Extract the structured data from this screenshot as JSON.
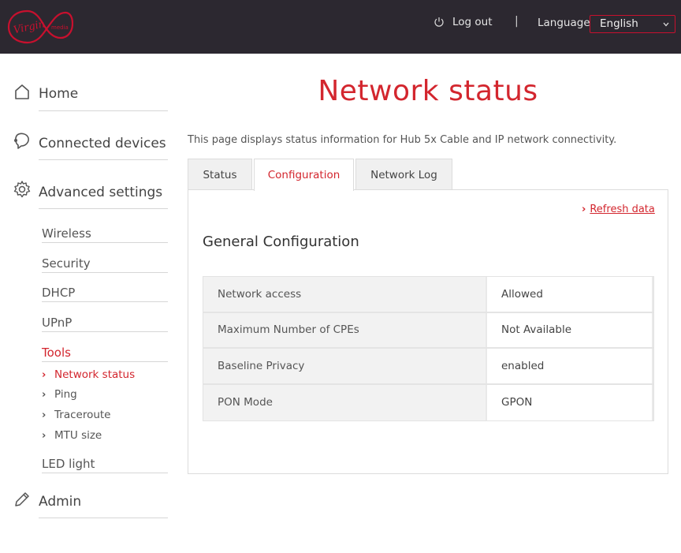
{
  "header": {
    "logo_text": "Virgin media",
    "logout_label": "Log out",
    "separator": "|",
    "language_label": "Language",
    "language_value": "English"
  },
  "sidebar": {
    "home": "Home",
    "connected_devices": "Connected devices",
    "advanced_settings": "Advanced settings",
    "sub": {
      "wireless": "Wireless",
      "security": "Security",
      "dhcp": "DHCP",
      "upnp": "UPnP",
      "tools": "Tools",
      "led_light": "LED light"
    },
    "tools_items": {
      "network_status": "Network status",
      "ping": "Ping",
      "traceroute": "Traceroute",
      "mtu_size": "MTU size"
    },
    "admin": "Admin"
  },
  "main": {
    "title": "Network status",
    "intro": "This page displays status information for Hub 5x Cable and IP network connectivity.",
    "tabs": [
      "Status",
      "Configuration",
      "Network Log"
    ],
    "active_tab": "Configuration",
    "refresh_label": "Refresh data",
    "section_title": "General Configuration",
    "rows": [
      {
        "key": "Network access",
        "value": "Allowed"
      },
      {
        "key": "Maximum Number of CPEs",
        "value": "Not Available"
      },
      {
        "key": "Baseline Privacy",
        "value": "enabled"
      },
      {
        "key": "PON Mode",
        "value": "GPON"
      }
    ]
  },
  "colors": {
    "header_bg": "#2c2830",
    "accent": "#d3262e",
    "border": "#dcdcdc"
  },
  "icons": [
    "virgin-media-logo",
    "power-icon",
    "chevron-down-icon",
    "home-icon",
    "devices-icon",
    "gear-icon",
    "pencil-icon",
    "chevron-right-icon"
  ]
}
